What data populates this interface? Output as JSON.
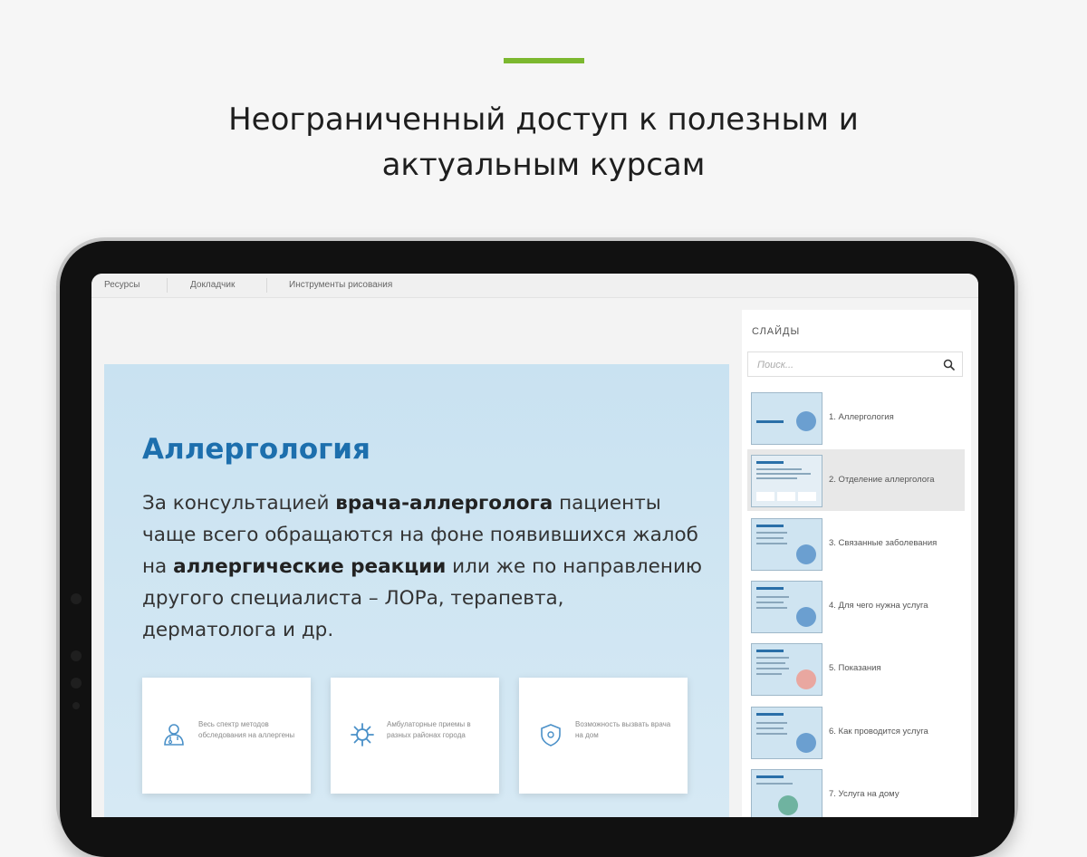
{
  "headline": {
    "line1": "Неограниченный доступ к полезным и",
    "line2": "актуальным курсам"
  },
  "topmenu": {
    "items": [
      "Ресурсы",
      "Докладчик",
      "Инструменты рисования"
    ]
  },
  "slide": {
    "title": "Аллергология",
    "body": {
      "t1": "За консультацией ",
      "b1": "врача-аллерголога",
      "t2": " пациенты чаще всего обращаются на фоне появившихся жалоб на ",
      "b2": "аллергические реакции",
      "t3": " или же по направлению другого специалиста – ЛОРа, терапевта, дерматолога и др."
    },
    "cards": [
      {
        "icon": "doctor-icon",
        "text": "Весь спектр методов обследования на аллергены"
      },
      {
        "icon": "virus-icon",
        "text": "Амбулаторные приемы в разных районах города"
      },
      {
        "icon": "shield-icon",
        "text": "Возможность вызвать врача на дом"
      }
    ]
  },
  "panel": {
    "title": "СЛАЙДЫ",
    "search_placeholder": "Поиск...",
    "items": [
      {
        "label": "1. Аллергология",
        "active": false
      },
      {
        "label": "2. Отделение аллерголога",
        "active": true
      },
      {
        "label": "3. Связанные заболевания",
        "active": false
      },
      {
        "label": "4. Для чего нужна услуга",
        "active": false
      },
      {
        "label": "5. Показания",
        "active": false
      },
      {
        "label": "6. Как проводится услуга",
        "active": false
      },
      {
        "label": "7. Услуга на дому",
        "active": false
      }
    ]
  },
  "colors": {
    "accent": "#7cb82f",
    "slide_title": "#1d6fad",
    "slide_bg": "#c9e2f1"
  }
}
